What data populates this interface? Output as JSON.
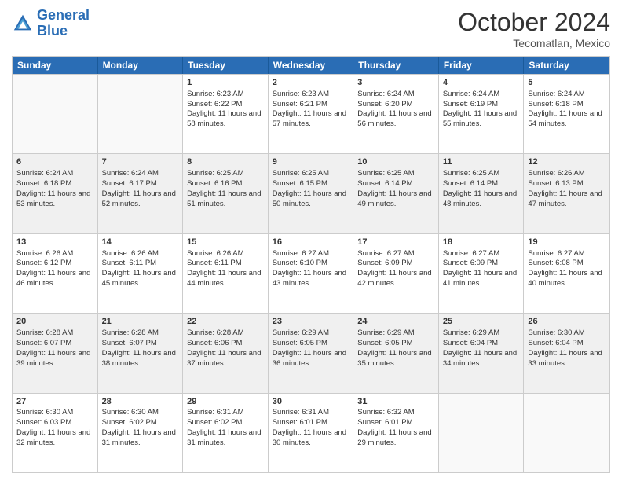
{
  "header": {
    "logo_line1": "General",
    "logo_line2": "Blue",
    "month": "October 2024",
    "location": "Tecomatlan, Mexico"
  },
  "days_of_week": [
    "Sunday",
    "Monday",
    "Tuesday",
    "Wednesday",
    "Thursday",
    "Friday",
    "Saturday"
  ],
  "rows": [
    [
      {
        "day": "",
        "empty": true
      },
      {
        "day": "",
        "empty": true
      },
      {
        "day": "1",
        "sunrise": "Sunrise: 6:23 AM",
        "sunset": "Sunset: 6:22 PM",
        "daylight": "Daylight: 11 hours and 58 minutes."
      },
      {
        "day": "2",
        "sunrise": "Sunrise: 6:23 AM",
        "sunset": "Sunset: 6:21 PM",
        "daylight": "Daylight: 11 hours and 57 minutes."
      },
      {
        "day": "3",
        "sunrise": "Sunrise: 6:24 AM",
        "sunset": "Sunset: 6:20 PM",
        "daylight": "Daylight: 11 hours and 56 minutes."
      },
      {
        "day": "4",
        "sunrise": "Sunrise: 6:24 AM",
        "sunset": "Sunset: 6:19 PM",
        "daylight": "Daylight: 11 hours and 55 minutes."
      },
      {
        "day": "5",
        "sunrise": "Sunrise: 6:24 AM",
        "sunset": "Sunset: 6:18 PM",
        "daylight": "Daylight: 11 hours and 54 minutes."
      }
    ],
    [
      {
        "day": "6",
        "sunrise": "Sunrise: 6:24 AM",
        "sunset": "Sunset: 6:18 PM",
        "daylight": "Daylight: 11 hours and 53 minutes.",
        "shaded": true
      },
      {
        "day": "7",
        "sunrise": "Sunrise: 6:24 AM",
        "sunset": "Sunset: 6:17 PM",
        "daylight": "Daylight: 11 hours and 52 minutes.",
        "shaded": true
      },
      {
        "day": "8",
        "sunrise": "Sunrise: 6:25 AM",
        "sunset": "Sunset: 6:16 PM",
        "daylight": "Daylight: 11 hours and 51 minutes.",
        "shaded": true
      },
      {
        "day": "9",
        "sunrise": "Sunrise: 6:25 AM",
        "sunset": "Sunset: 6:15 PM",
        "daylight": "Daylight: 11 hours and 50 minutes.",
        "shaded": true
      },
      {
        "day": "10",
        "sunrise": "Sunrise: 6:25 AM",
        "sunset": "Sunset: 6:14 PM",
        "daylight": "Daylight: 11 hours and 49 minutes.",
        "shaded": true
      },
      {
        "day": "11",
        "sunrise": "Sunrise: 6:25 AM",
        "sunset": "Sunset: 6:14 PM",
        "daylight": "Daylight: 11 hours and 48 minutes.",
        "shaded": true
      },
      {
        "day": "12",
        "sunrise": "Sunrise: 6:26 AM",
        "sunset": "Sunset: 6:13 PM",
        "daylight": "Daylight: 11 hours and 47 minutes.",
        "shaded": true
      }
    ],
    [
      {
        "day": "13",
        "sunrise": "Sunrise: 6:26 AM",
        "sunset": "Sunset: 6:12 PM",
        "daylight": "Daylight: 11 hours and 46 minutes."
      },
      {
        "day": "14",
        "sunrise": "Sunrise: 6:26 AM",
        "sunset": "Sunset: 6:11 PM",
        "daylight": "Daylight: 11 hours and 45 minutes."
      },
      {
        "day": "15",
        "sunrise": "Sunrise: 6:26 AM",
        "sunset": "Sunset: 6:11 PM",
        "daylight": "Daylight: 11 hours and 44 minutes."
      },
      {
        "day": "16",
        "sunrise": "Sunrise: 6:27 AM",
        "sunset": "Sunset: 6:10 PM",
        "daylight": "Daylight: 11 hours and 43 minutes."
      },
      {
        "day": "17",
        "sunrise": "Sunrise: 6:27 AM",
        "sunset": "Sunset: 6:09 PM",
        "daylight": "Daylight: 11 hours and 42 minutes."
      },
      {
        "day": "18",
        "sunrise": "Sunrise: 6:27 AM",
        "sunset": "Sunset: 6:09 PM",
        "daylight": "Daylight: 11 hours and 41 minutes."
      },
      {
        "day": "19",
        "sunrise": "Sunrise: 6:27 AM",
        "sunset": "Sunset: 6:08 PM",
        "daylight": "Daylight: 11 hours and 40 minutes."
      }
    ],
    [
      {
        "day": "20",
        "sunrise": "Sunrise: 6:28 AM",
        "sunset": "Sunset: 6:07 PM",
        "daylight": "Daylight: 11 hours and 39 minutes.",
        "shaded": true
      },
      {
        "day": "21",
        "sunrise": "Sunrise: 6:28 AM",
        "sunset": "Sunset: 6:07 PM",
        "daylight": "Daylight: 11 hours and 38 minutes.",
        "shaded": true
      },
      {
        "day": "22",
        "sunrise": "Sunrise: 6:28 AM",
        "sunset": "Sunset: 6:06 PM",
        "daylight": "Daylight: 11 hours and 37 minutes.",
        "shaded": true
      },
      {
        "day": "23",
        "sunrise": "Sunrise: 6:29 AM",
        "sunset": "Sunset: 6:05 PM",
        "daylight": "Daylight: 11 hours and 36 minutes.",
        "shaded": true
      },
      {
        "day": "24",
        "sunrise": "Sunrise: 6:29 AM",
        "sunset": "Sunset: 6:05 PM",
        "daylight": "Daylight: 11 hours and 35 minutes.",
        "shaded": true
      },
      {
        "day": "25",
        "sunrise": "Sunrise: 6:29 AM",
        "sunset": "Sunset: 6:04 PM",
        "daylight": "Daylight: 11 hours and 34 minutes.",
        "shaded": true
      },
      {
        "day": "26",
        "sunrise": "Sunrise: 6:30 AM",
        "sunset": "Sunset: 6:04 PM",
        "daylight": "Daylight: 11 hours and 33 minutes.",
        "shaded": true
      }
    ],
    [
      {
        "day": "27",
        "sunrise": "Sunrise: 6:30 AM",
        "sunset": "Sunset: 6:03 PM",
        "daylight": "Daylight: 11 hours and 32 minutes."
      },
      {
        "day": "28",
        "sunrise": "Sunrise: 6:30 AM",
        "sunset": "Sunset: 6:02 PM",
        "daylight": "Daylight: 11 hours and 31 minutes."
      },
      {
        "day": "29",
        "sunrise": "Sunrise: 6:31 AM",
        "sunset": "Sunset: 6:02 PM",
        "daylight": "Daylight: 11 hours and 31 minutes."
      },
      {
        "day": "30",
        "sunrise": "Sunrise: 6:31 AM",
        "sunset": "Sunset: 6:01 PM",
        "daylight": "Daylight: 11 hours and 30 minutes."
      },
      {
        "day": "31",
        "sunrise": "Sunrise: 6:32 AM",
        "sunset": "Sunset: 6:01 PM",
        "daylight": "Daylight: 11 hours and 29 minutes."
      },
      {
        "day": "",
        "empty": true
      },
      {
        "day": "",
        "empty": true
      }
    ]
  ]
}
